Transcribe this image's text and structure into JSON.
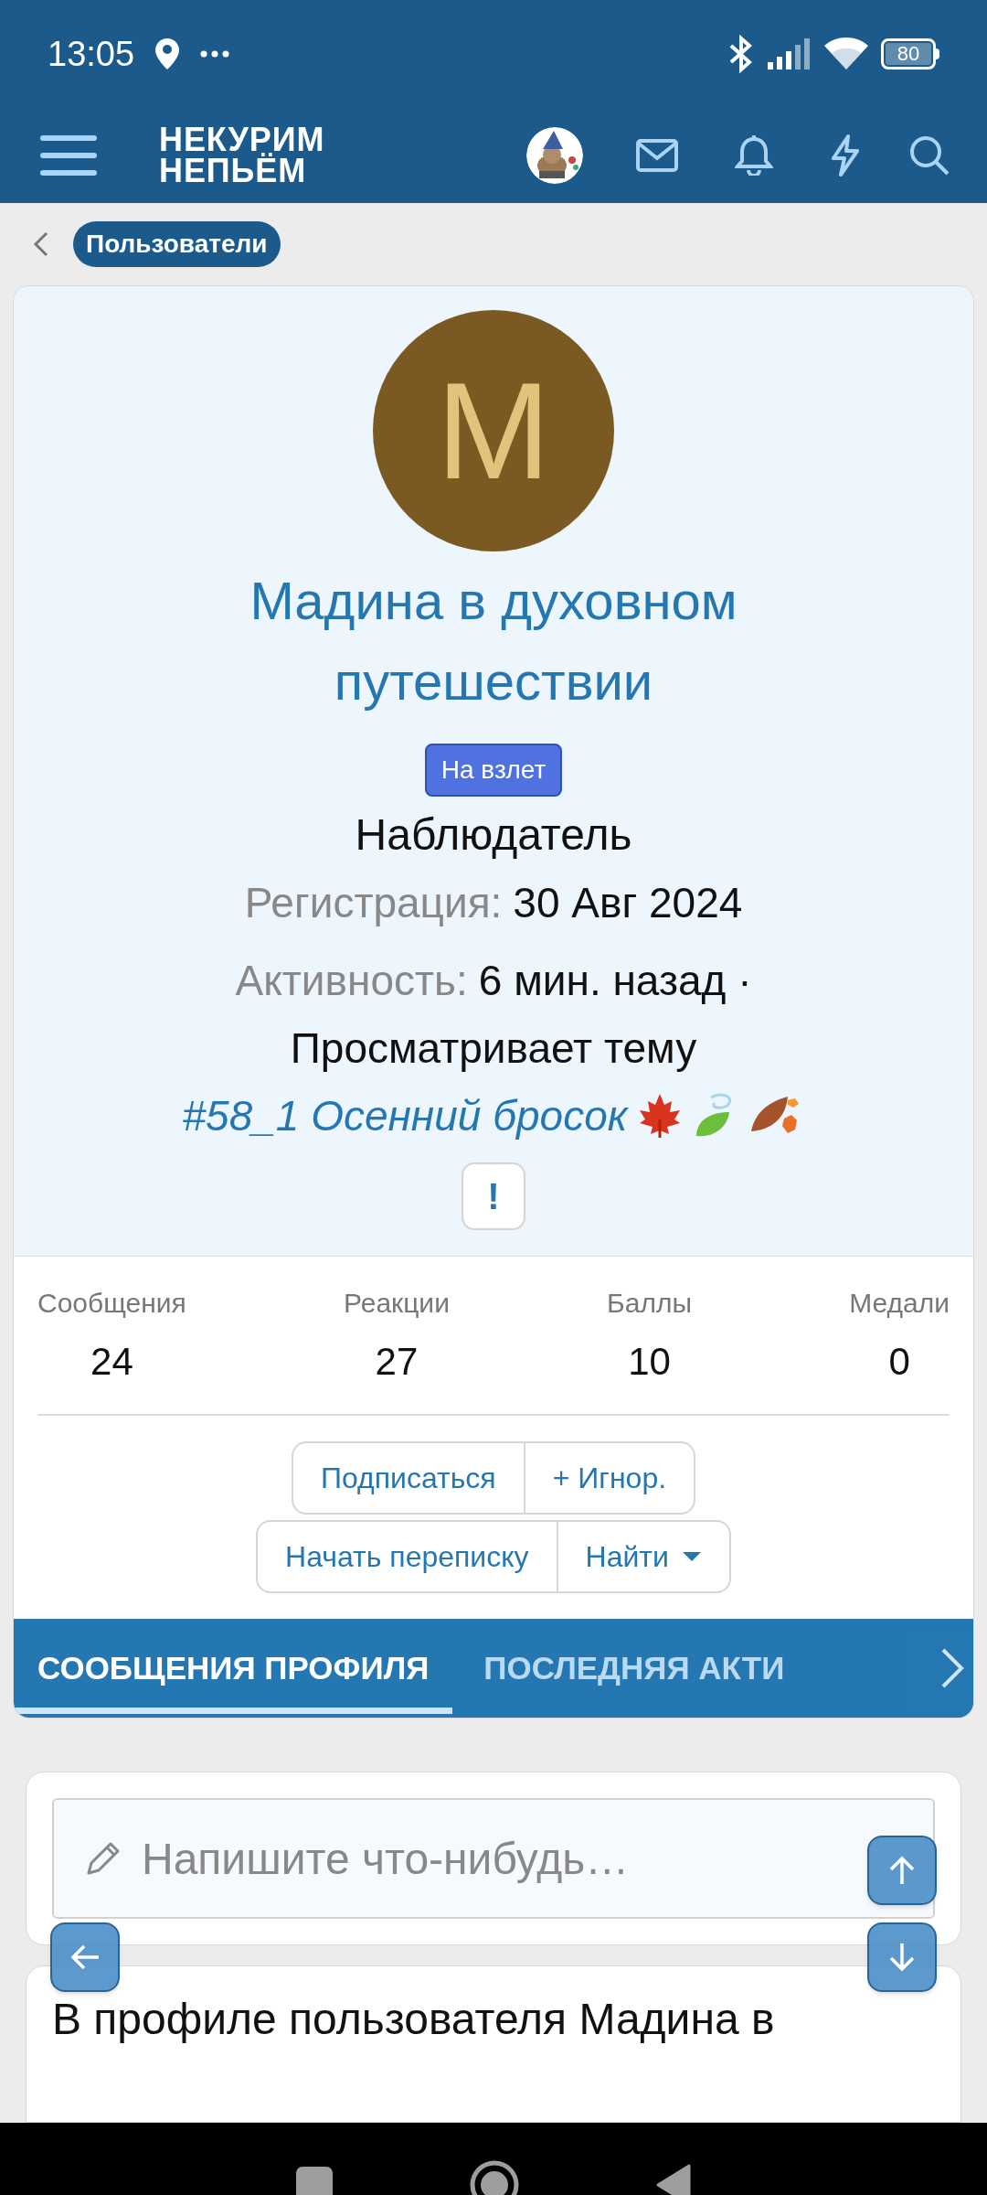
{
  "status_bar": {
    "time": "13:05",
    "battery": "80"
  },
  "header": {
    "logo_lines": [
      "НЕКУРИМ",
      "НЕПЬЁМ"
    ]
  },
  "breadcrumb": {
    "label": "Пользователи"
  },
  "profile": {
    "avatar_letter": "М",
    "name": "Мадина в духовном путешествии",
    "badge": "На взлет",
    "title": "Наблюдатель",
    "registration": {
      "label": "Регистрация:",
      "value": "30 Авг 2024"
    },
    "activity": {
      "label": "Активность:",
      "value": "6 мин. назад ·",
      "viewing": "Просматривает тему",
      "topic": "#58_1 Осенний бросок"
    },
    "warn_button": "!"
  },
  "stats": [
    {
      "label": "Сообщения",
      "value": "24"
    },
    {
      "label": "Реакции",
      "value": "27"
    },
    {
      "label": "Баллы",
      "value": "10"
    },
    {
      "label": "Медали",
      "value": "0"
    }
  ],
  "button_rows": [
    [
      {
        "label": "Подписаться",
        "dropdown": false
      },
      {
        "label": "+ Игнор.",
        "dropdown": false
      }
    ],
    [
      {
        "label": "Начать переписку",
        "dropdown": false
      },
      {
        "label": "Найти",
        "dropdown": true
      }
    ]
  ],
  "tabs": [
    {
      "label": "СООБЩЕНИЯ ПРОФИЛЯ",
      "selected": true
    },
    {
      "label": "ПОСЛЕДНЯЯ АКТИ",
      "selected": false
    }
  ],
  "composer": {
    "placeholder": "Напишите что-нибудь…"
  },
  "message": {
    "text": "В профиле пользователя Мадина в"
  }
}
